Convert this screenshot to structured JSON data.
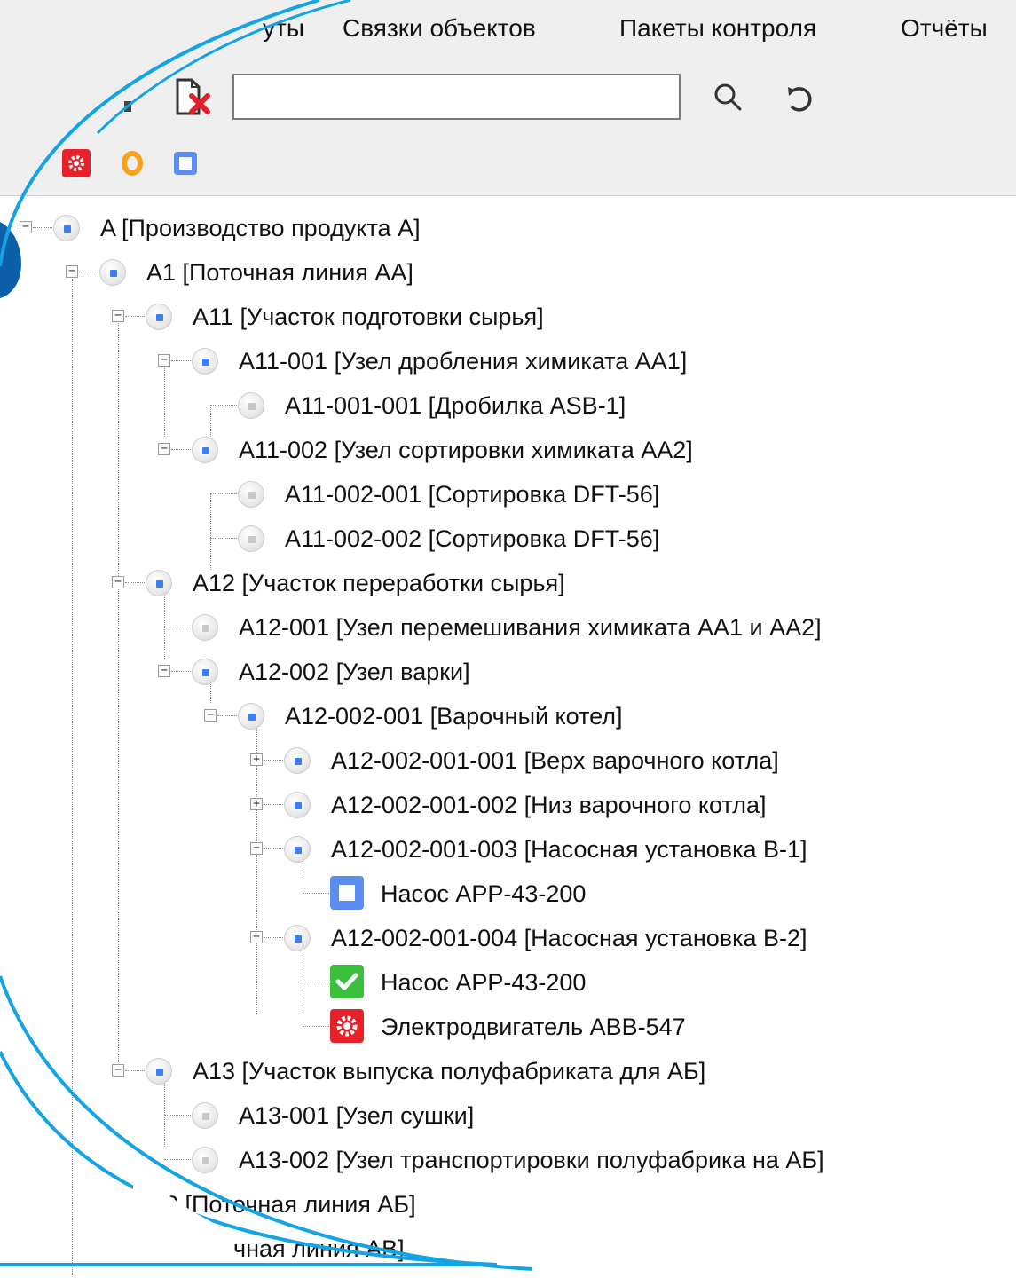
{
  "menu": {
    "items": [
      {
        "label": "уты"
      },
      {
        "label": "Связки объектов"
      },
      {
        "label": "Пакеты контроля"
      },
      {
        "label": "Отчёты"
      }
    ]
  },
  "toolbar": {
    "search": {
      "value": "",
      "placeholder": ""
    },
    "buttons": [
      {
        "icon": "document-delete-icon"
      },
      {
        "icon": "search-icon"
      },
      {
        "icon": "refresh-icon"
      }
    ],
    "filters": [
      {
        "icon": "gear-alert-icon",
        "color": "#e8202a"
      },
      {
        "icon": "circle-orange-icon",
        "color": "#f7a21b"
      },
      {
        "icon": "square-blue-icon",
        "color": "#5b8ef0"
      }
    ]
  },
  "tree": {
    "nodes": [
      {
        "label": "A [Производство продукта A]"
      },
      {
        "label": "A1 [Поточная линия AA]"
      },
      {
        "label": "A11 [Участок подготовки сырья]"
      },
      {
        "label": "A11-001 [Узел дробления химиката AA1]"
      },
      {
        "label": "A11-001-001 [Дробилка ASB-1]"
      },
      {
        "label": "A11-002 [Узел сортировки химиката AA2]"
      },
      {
        "label": "A11-002-001 [Сортировка DFT-56]"
      },
      {
        "label": "A11-002-002 [Сортировка DFT-56]"
      },
      {
        "label": "A12 [Участок переработки сырья]"
      },
      {
        "label": "A12-001 [Узел перемешивания химиката AA1 и AA2]"
      },
      {
        "label": "A12-002 [Узел варки]"
      },
      {
        "label": "A12-002-001 [Варочный котел]"
      },
      {
        "label": "A12-002-001-001 [Верх варочного котла]"
      },
      {
        "label": "A12-002-001-002 [Низ варочного котла]"
      },
      {
        "label": "A12-002-001-003 [Насосная установка B-1]"
      },
      {
        "label": "Насос APP-43-200",
        "status": "unknown"
      },
      {
        "label": "A12-002-001-004 [Насосная установка B-2]"
      },
      {
        "label": "Насос APP-43-200",
        "status": "ok"
      },
      {
        "label": "Электродвигатель ABB-547",
        "status": "alarm"
      },
      {
        "label": "A13 [Участок выпуска полуфабриката для АБ]"
      },
      {
        "label": "A13-001 [Узел сушки]"
      },
      {
        "label": "A13-002 [Узел транспортировки полуфабрика на АБ]"
      },
      {
        "label": "2 [Поточная линия АБ]"
      },
      {
        "label": "чная линия АВ]"
      }
    ]
  },
  "colors": {
    "accent_arc": "#14a4e6",
    "node_blue": "#3d7df5",
    "status_ok": "#3cbf3c",
    "status_alarm": "#e8202a",
    "status_unknown": "#5b8ef0"
  }
}
